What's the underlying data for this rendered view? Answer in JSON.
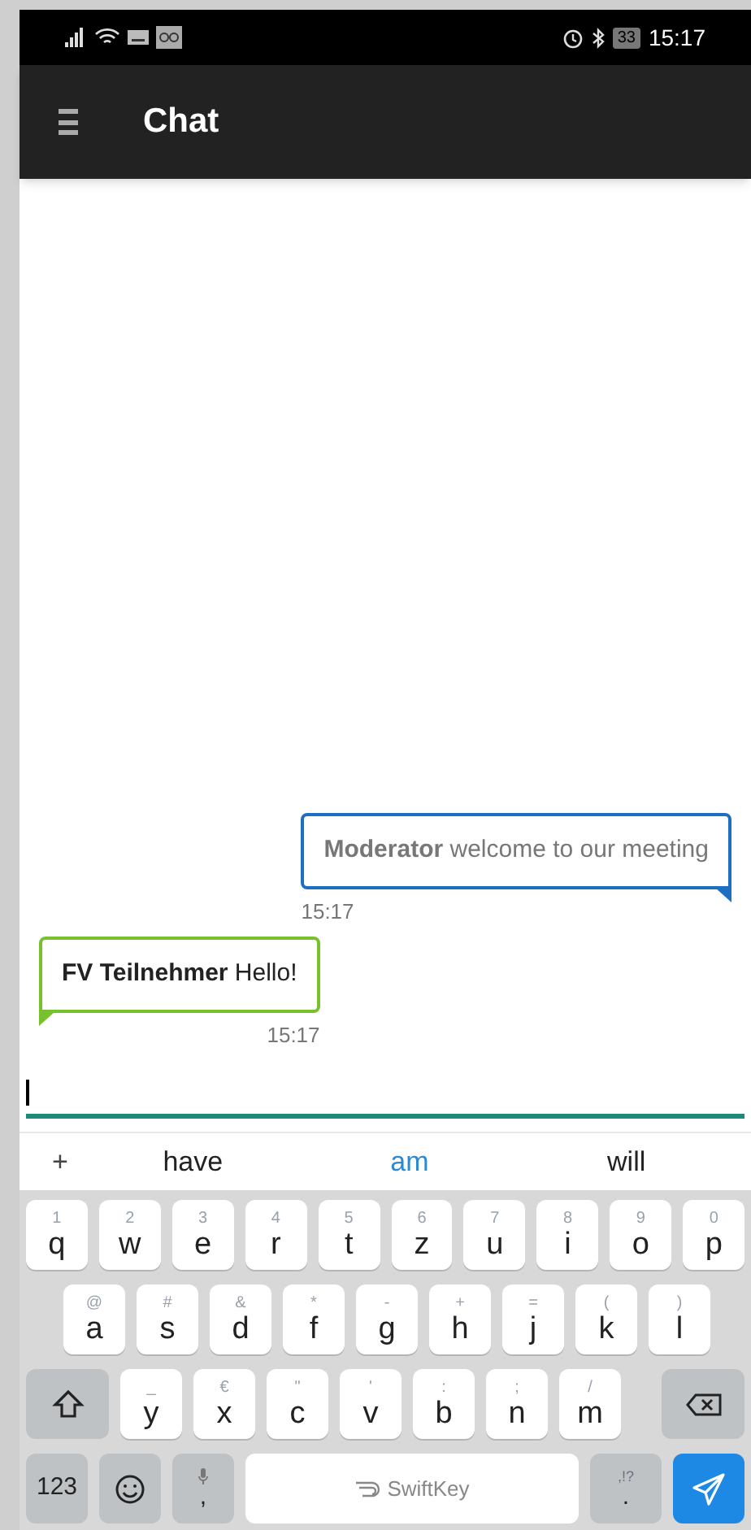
{
  "status_bar": {
    "battery": "33",
    "time": "15:17"
  },
  "app_bar": {
    "title": "Chat"
  },
  "messages": [
    {
      "kind": "outgoing",
      "sender": "Moderator",
      "text": "welcome to our meeting",
      "time": "15:17",
      "color": "#1e6fc4"
    },
    {
      "kind": "incoming",
      "sender": "FV Teilnehmer",
      "text": "Hello!",
      "time": "15:17",
      "color": "#76c12c"
    }
  ],
  "message_input": {
    "focused": true
  },
  "suggestions": {
    "add": "+",
    "words": [
      {
        "label": "have",
        "selected": false
      },
      {
        "label": "am",
        "selected": true
      },
      {
        "label": "will",
        "selected": false
      }
    ]
  },
  "keyboard": {
    "rows": [
      [
        {
          "hint": "1",
          "label": "q"
        },
        {
          "hint": "2",
          "label": "w"
        },
        {
          "hint": "3",
          "label": "e"
        },
        {
          "hint": "4",
          "label": "r"
        },
        {
          "hint": "5",
          "label": "t"
        },
        {
          "hint": "6",
          "label": "z"
        },
        {
          "hint": "7",
          "label": "u"
        },
        {
          "hint": "8",
          "label": "i"
        },
        {
          "hint": "9",
          "label": "o"
        },
        {
          "hint": "0",
          "label": "p"
        }
      ],
      [
        {
          "hint": "@",
          "label": "a"
        },
        {
          "hint": "#",
          "label": "s"
        },
        {
          "hint": "&",
          "label": "d"
        },
        {
          "hint": "*",
          "label": "f"
        },
        {
          "hint": "-",
          "label": "g"
        },
        {
          "hint": "+",
          "label": "h"
        },
        {
          "hint": "=",
          "label": "j"
        },
        {
          "hint": "(",
          "label": "k"
        },
        {
          "hint": ")",
          "label": "l"
        }
      ],
      [
        {
          "hint": "_",
          "label": "y"
        },
        {
          "hint": "€",
          "label": "x"
        },
        {
          "hint": "\"",
          "label": "c"
        },
        {
          "hint": "'",
          "label": "v"
        },
        {
          "hint": ":",
          "label": "b"
        },
        {
          "hint": ";",
          "label": "n"
        },
        {
          "hint": "/",
          "label": "m"
        }
      ]
    ],
    "numbers_key": "123",
    "comma_key": ",",
    "space_key": "SwiftKey",
    "period_key": {
      "hint": ",!?",
      "label": "."
    }
  }
}
